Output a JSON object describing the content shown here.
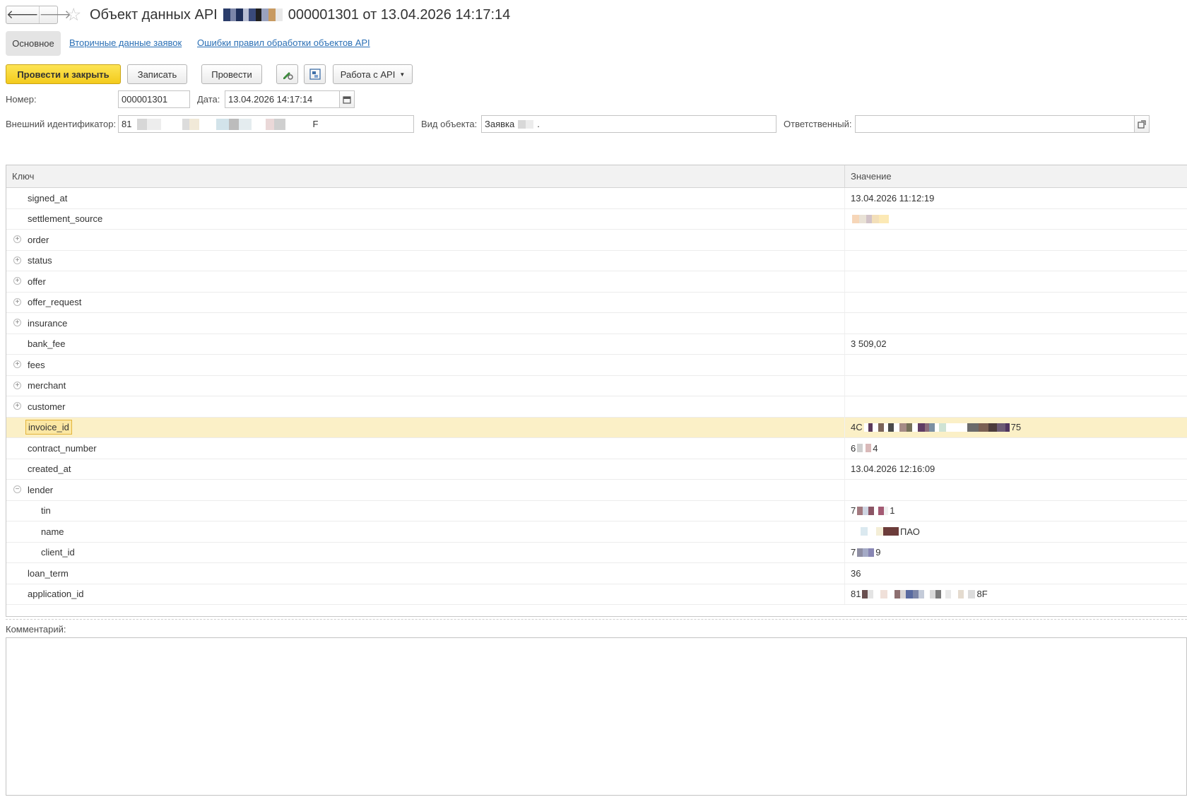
{
  "title": {
    "prefix": "Объект данных API",
    "suffix": "000001301 от 13.04.2026 14:17:14"
  },
  "nav": {
    "back_icon": "arrow-left-icon",
    "forward_icon": "arrow-right-icon",
    "favorite_icon": "star-icon"
  },
  "tabs": {
    "main": "Основное",
    "secondary": "Вторичные данные заявок",
    "errors": "Ошибки правил обработки объектов API"
  },
  "toolbar": {
    "post_close": "Провести и закрыть",
    "save": "Записать",
    "post": "Провести",
    "edit_icon": "pencil-gear-icon",
    "structure_icon": "document-structure-icon",
    "api_menu": "Работа с API"
  },
  "form": {
    "number_label": "Номер:",
    "number_value": "000001301",
    "date_label": "Дата:",
    "date_value": "13.04.2026 14:17:14",
    "date_icon": "calendar-icon",
    "external_id_label": "Внешний идентификатор:",
    "external_id_prefix": "81",
    "external_id_suffix": "F",
    "object_type_label": "Вид объекта:",
    "object_type_value": "Заявка",
    "object_type_tail": ".",
    "responsible_label": "Ответственный:",
    "responsible_value": "",
    "responsible_icon": "open-link-icon"
  },
  "table": {
    "headers": {
      "key": "Ключ",
      "value": "Значение"
    },
    "rows": [
      {
        "key": "signed_at",
        "value": "13.04.2026 11:12:19",
        "toggle": "",
        "indent": 0
      },
      {
        "key": "settlement_source",
        "value": "",
        "toggle": "",
        "indent": 0
      },
      {
        "key": "order",
        "value": "",
        "toggle": "⊕",
        "indent": 0
      },
      {
        "key": "status",
        "value": "",
        "toggle": "⊕",
        "indent": 0
      },
      {
        "key": "offer",
        "value": "",
        "toggle": "⊕",
        "indent": 0
      },
      {
        "key": "offer_request",
        "value": "",
        "toggle": "⊕",
        "indent": 0
      },
      {
        "key": "insurance",
        "value": "",
        "toggle": "⊕",
        "indent": 0
      },
      {
        "key": "bank_fee",
        "value": "3 509,02",
        "toggle": "",
        "indent": 0
      },
      {
        "key": "fees",
        "value": "",
        "toggle": "⊕",
        "indent": 0
      },
      {
        "key": "merchant",
        "value": "",
        "toggle": "⊕",
        "indent": 0
      },
      {
        "key": "customer",
        "value": "",
        "toggle": "⊕",
        "indent": 0
      },
      {
        "key": "invoice_id",
        "value": "4С",
        "value_tail": "75",
        "toggle": "",
        "indent": 0,
        "selected": true
      },
      {
        "key": "contract_number",
        "value": "6",
        "value_tail": "4",
        "toggle": "",
        "indent": 0
      },
      {
        "key": "created_at",
        "value": "13.04.2026 12:16:09",
        "toggle": "",
        "indent": 0
      },
      {
        "key": "lender",
        "value": "",
        "toggle": "⊖",
        "indent": 0
      },
      {
        "key": "tin",
        "value": "7",
        "value_tail": "1",
        "toggle": "",
        "indent": 1
      },
      {
        "key": "name",
        "value": "",
        "value_tail": "ПАО",
        "toggle": "",
        "indent": 1
      },
      {
        "key": "client_id",
        "value": "7",
        "value_tail": "9",
        "toggle": "",
        "indent": 1
      },
      {
        "key": "loan_term",
        "value": "36",
        "toggle": "",
        "indent": 0
      },
      {
        "key": "application_id",
        "value": "81",
        "value_tail": "8F",
        "toggle": "",
        "indent": 0
      }
    ]
  },
  "comment": {
    "label": "Комментарий:",
    "value": ""
  },
  "colors": {
    "primary_button": "#f3cb1c",
    "link": "#2a6fb5",
    "selected_row": "#fbf0c7"
  }
}
